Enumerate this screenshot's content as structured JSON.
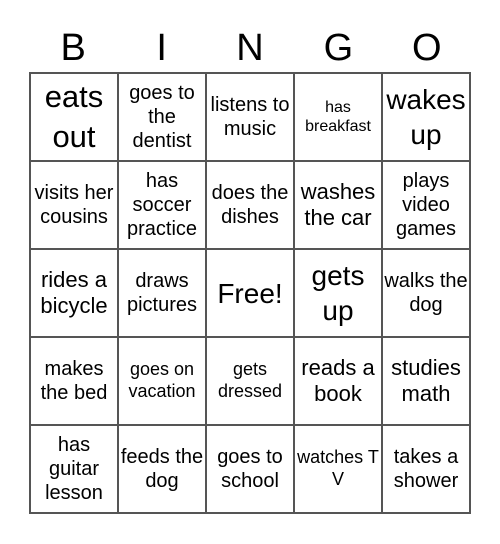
{
  "header": {
    "letters": [
      "B",
      "I",
      "N",
      "G",
      "O"
    ]
  },
  "cells": [
    {
      "text": "eats out",
      "size": "s-xl"
    },
    {
      "text": "goes to the dentist",
      "size": "s-sm"
    },
    {
      "text": "listens to music",
      "size": "s-sm"
    },
    {
      "text": "has breakfast",
      "size": "s-xxs"
    },
    {
      "text": "wakes up",
      "size": "s-lg"
    },
    {
      "text": "visits her cousins",
      "size": "s-sm"
    },
    {
      "text": "has soccer practice",
      "size": "s-sm"
    },
    {
      "text": "does the dishes",
      "size": "s-sm"
    },
    {
      "text": "washes the car",
      "size": "s-md"
    },
    {
      "text": "plays video games",
      "size": "s-sm"
    },
    {
      "text": "rides a bicycle",
      "size": "s-md"
    },
    {
      "text": "draws pictures",
      "size": "s-sm"
    },
    {
      "text": "Free!",
      "size": "s-lg"
    },
    {
      "text": "gets up",
      "size": "s-lg"
    },
    {
      "text": "walks the dog",
      "size": "s-sm"
    },
    {
      "text": "makes the bed",
      "size": "s-sm"
    },
    {
      "text": "goes on vacation",
      "size": "s-xs"
    },
    {
      "text": "gets dressed",
      "size": "s-xs"
    },
    {
      "text": "reads a book",
      "size": "s-md"
    },
    {
      "text": "studies math",
      "size": "s-md"
    },
    {
      "text": "has guitar lesson",
      "size": "s-sm"
    },
    {
      "text": "feeds the dog",
      "size": "s-sm"
    },
    {
      "text": "goes to school",
      "size": "s-sm"
    },
    {
      "text": "watches T V",
      "size": "s-xs"
    },
    {
      "text": "takes a shower",
      "size": "s-sm"
    }
  ]
}
